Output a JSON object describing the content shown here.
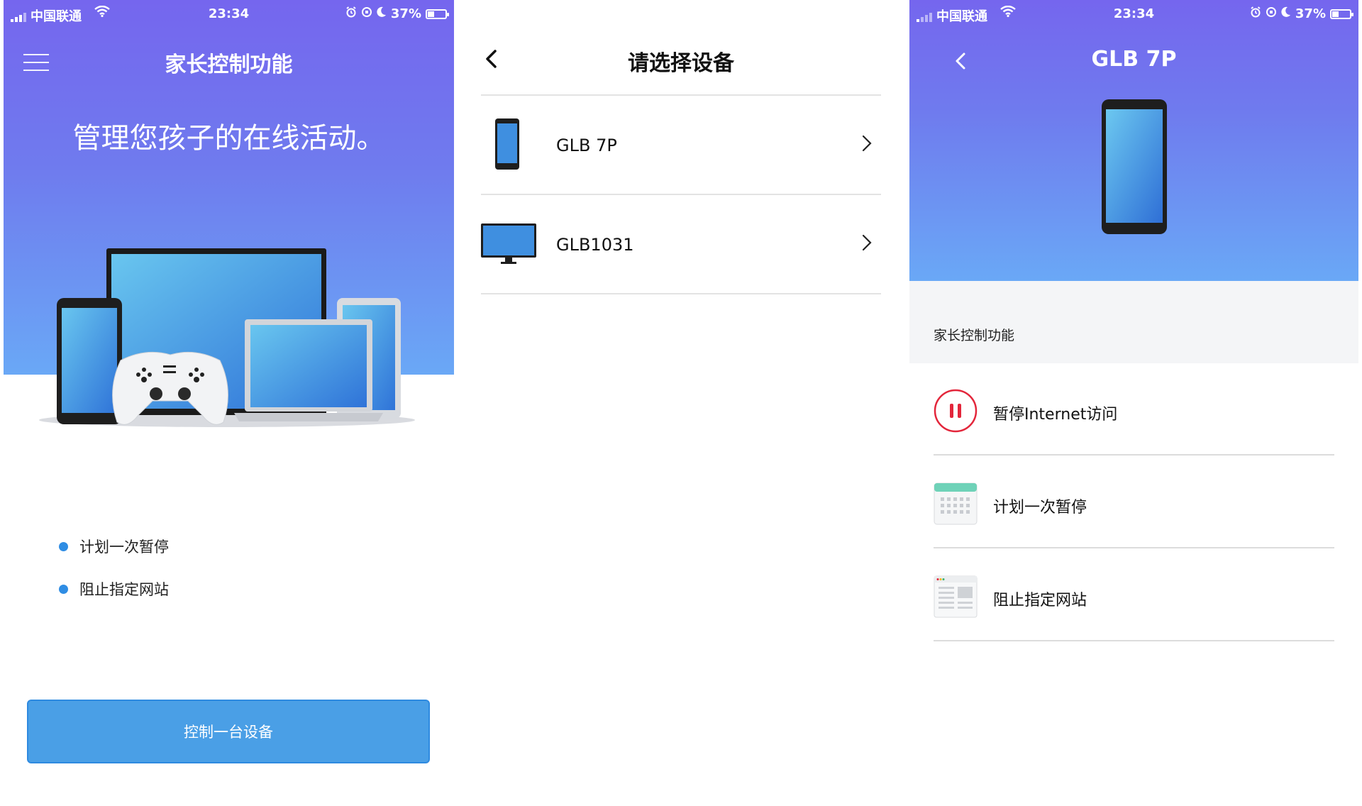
{
  "status_bar": {
    "carrier": "中国联通",
    "time": "23:34",
    "battery": "37%"
  },
  "intro_screen": {
    "title": "家长控制功能",
    "headline": "管理您孩子的在线活动。",
    "features": [
      "计划一次暂停",
      "阻止指定网站"
    ],
    "cta_label": "控制一台设备"
  },
  "device_list_screen": {
    "title": "请选择设备",
    "devices": [
      {
        "name": "GLB 7P",
        "icon": "phone-icon"
      },
      {
        "name": "GLB1031",
        "icon": "monitor-icon"
      }
    ]
  },
  "device_detail_screen": {
    "title": "GLB 7P",
    "section_header": "家长控制功能",
    "options": [
      {
        "label": "暂停Internet访问",
        "icon": "pause-icon"
      },
      {
        "label": "计划一次暂停",
        "icon": "calendar-icon"
      },
      {
        "label": "阻止指定网站",
        "icon": "webpage-icon"
      }
    ]
  },
  "colors": {
    "header_gradient_top": "#7566ee",
    "header_gradient_bottom": "#6aa8f6",
    "accent_blue": "#4a9fe6",
    "bullet_blue": "#2f8de4",
    "pause_red": "#e3263b"
  }
}
